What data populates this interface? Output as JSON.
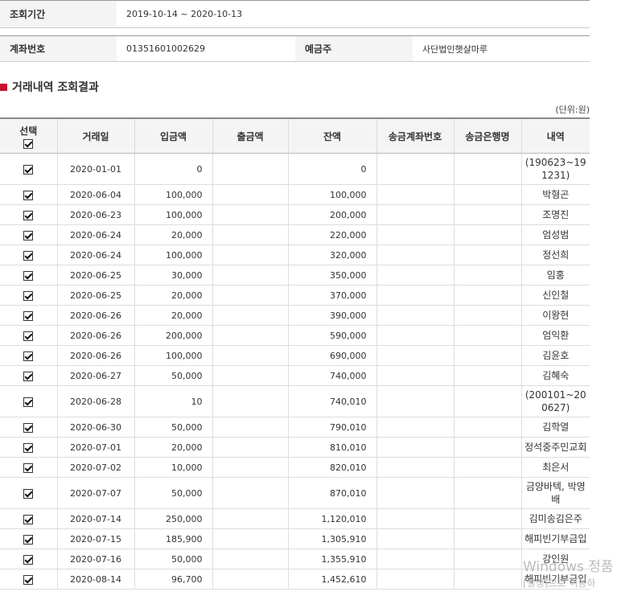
{
  "info": {
    "period_label": "조회기간",
    "period_value": "2019-10-14 ~ 2020-10-13",
    "account_label": "계좌번호",
    "account_value": "01351601002629",
    "holder_label": "예금주",
    "holder_value": "사단법인햇살마루"
  },
  "section_title": "거래내역 조회결과",
  "unit": "(단위:원)",
  "columns": {
    "select": "선택",
    "date": "거래일",
    "deposit": "입금액",
    "withdraw": "출금액",
    "balance": "잔액",
    "send_account": "송금계좌번호",
    "send_bank": "송금은행명",
    "desc": "내역"
  },
  "rows": [
    {
      "date": "2020-01-01",
      "deposit": "0",
      "withdraw": "",
      "balance": "0",
      "send_account": "",
      "send_bank": "",
      "desc": "(190623~191231)",
      "tall": true
    },
    {
      "date": "2020-06-04",
      "deposit": "100,000",
      "withdraw": "",
      "balance": "100,000",
      "send_account": "",
      "send_bank": "",
      "desc": "박형곤"
    },
    {
      "date": "2020-06-23",
      "deposit": "100,000",
      "withdraw": "",
      "balance": "200,000",
      "send_account": "",
      "send_bank": "",
      "desc": "조명진"
    },
    {
      "date": "2020-06-24",
      "deposit": "20,000",
      "withdraw": "",
      "balance": "220,000",
      "send_account": "",
      "send_bank": "",
      "desc": "엄성범"
    },
    {
      "date": "2020-06-24",
      "deposit": "100,000",
      "withdraw": "",
      "balance": "320,000",
      "send_account": "",
      "send_bank": "",
      "desc": "정선희"
    },
    {
      "date": "2020-06-25",
      "deposit": "30,000",
      "withdraw": "",
      "balance": "350,000",
      "send_account": "",
      "send_bank": "",
      "desc": "임홍"
    },
    {
      "date": "2020-06-25",
      "deposit": "20,000",
      "withdraw": "",
      "balance": "370,000",
      "send_account": "",
      "send_bank": "",
      "desc": "신인철"
    },
    {
      "date": "2020-06-26",
      "deposit": "20,000",
      "withdraw": "",
      "balance": "390,000",
      "send_account": "",
      "send_bank": "",
      "desc": "이왕현"
    },
    {
      "date": "2020-06-26",
      "deposit": "200,000",
      "withdraw": "",
      "balance": "590,000",
      "send_account": "",
      "send_bank": "",
      "desc": "엄익환"
    },
    {
      "date": "2020-06-26",
      "deposit": "100,000",
      "withdraw": "",
      "balance": "690,000",
      "send_account": "",
      "send_bank": "",
      "desc": "김윤호"
    },
    {
      "date": "2020-06-27",
      "deposit": "50,000",
      "withdraw": "",
      "balance": "740,000",
      "send_account": "",
      "send_bank": "",
      "desc": "김혜숙"
    },
    {
      "date": "2020-06-28",
      "deposit": "10",
      "withdraw": "",
      "balance": "740,010",
      "send_account": "",
      "send_bank": "",
      "desc": "(200101~200627)",
      "tall": true
    },
    {
      "date": "2020-06-30",
      "deposit": "50,000",
      "withdraw": "",
      "balance": "790,010",
      "send_account": "",
      "send_bank": "",
      "desc": "김학열"
    },
    {
      "date": "2020-07-01",
      "deposit": "20,000",
      "withdraw": "",
      "balance": "810,010",
      "send_account": "",
      "send_bank": "",
      "desc": "정석중주민교회"
    },
    {
      "date": "2020-07-02",
      "deposit": "10,000",
      "withdraw": "",
      "balance": "820,010",
      "send_account": "",
      "send_bank": "",
      "desc": "최은서"
    },
    {
      "date": "2020-07-07",
      "deposit": "50,000",
      "withdraw": "",
      "balance": "870,010",
      "send_account": "",
      "send_bank": "",
      "desc": "금양바텍, 박영배",
      "tall": true
    },
    {
      "date": "2020-07-14",
      "deposit": "250,000",
      "withdraw": "",
      "balance": "1,120,010",
      "send_account": "",
      "send_bank": "",
      "desc": "김미송김은주"
    },
    {
      "date": "2020-07-15",
      "deposit": "185,900",
      "withdraw": "",
      "balance": "1,305,910",
      "send_account": "",
      "send_bank": "",
      "desc": "해피빈기부금입"
    },
    {
      "date": "2020-07-16",
      "deposit": "50,000",
      "withdraw": "",
      "balance": "1,355,910",
      "send_account": "",
      "send_bank": "",
      "desc": "강인원"
    },
    {
      "date": "2020-08-14",
      "deposit": "96,700",
      "withdraw": "",
      "balance": "1,452,610",
      "send_account": "",
      "send_bank": "",
      "desc": "해피빈기부금입"
    }
  ],
  "watermark": {
    "line1": "Windows 정품",
    "line2": "[설정]으로 이동하"
  },
  "colors": {
    "accent": "#c8102e",
    "header_bg": "#f4f4f4"
  }
}
